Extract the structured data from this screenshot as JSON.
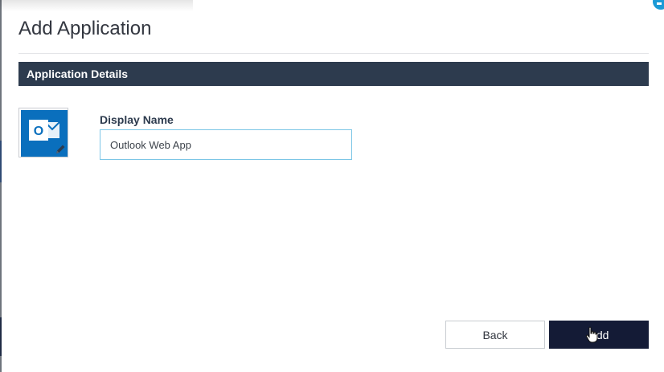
{
  "modal": {
    "title": "Add Application"
  },
  "section": {
    "title": "Application Details"
  },
  "app_icon": {
    "icon_name": "outlook-icon",
    "edit_icon_name": "pencil-icon",
    "brand_color": "#0a6fbd",
    "letter": "O"
  },
  "display_name": {
    "label": "Display Name",
    "value": "Outlook Web App"
  },
  "actions": {
    "back_label": "Back",
    "add_label": "Add"
  },
  "colors": {
    "section_bar": "#2d3b4e",
    "primary_button": "#141b36",
    "input_focus_border": "#7cc6e6",
    "close_accent": "#1b9ad6"
  }
}
